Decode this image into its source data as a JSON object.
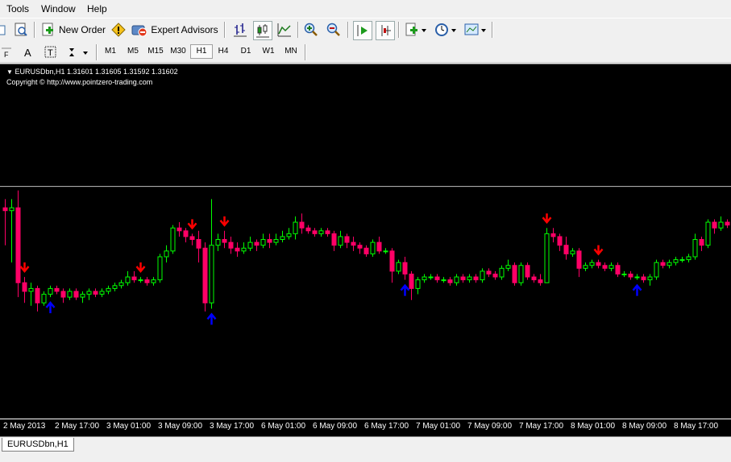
{
  "menu": {
    "items": [
      "Tools",
      "Window",
      "Help"
    ]
  },
  "toolbar": {
    "new_order": "New Order",
    "expert_advisors": "Expert Advisors"
  },
  "timeframes": {
    "items": [
      "M1",
      "M5",
      "M15",
      "M30",
      "H1",
      "H4",
      "D1",
      "W1",
      "MN"
    ],
    "active": "H1"
  },
  "chart": {
    "symbol_line": "EURUSDbn,H1  1.31601 1.31605 1.31592 1.31602",
    "copyright": "Copyright © http://www.pointzero-trading.com",
    "xaxis": [
      "2 May 2013",
      "2 May 17:00",
      "3 May 01:00",
      "3 May 09:00",
      "3 May 17:00",
      "6 May 01:00",
      "6 May 09:00",
      "6 May 17:00",
      "7 May 01:00",
      "7 May 09:00",
      "7 May 17:00",
      "8 May 01:00",
      "8 May 09:00",
      "8 May 17:00"
    ]
  },
  "chart_data": {
    "type": "candlestick",
    "symbol": "EURUSDbn",
    "timeframe": "H1",
    "last_quote": {
      "open": 1.31601,
      "high": 1.31605,
      "low": 1.31592,
      "close": 1.31602
    },
    "colors": {
      "bull": "#00ff00",
      "bear": "#ff0066",
      "background": "#000000",
      "foreground": "#ffffff",
      "bid_line": "#c0c0c0",
      "up_arrow": "#0000ff",
      "down_arrow": "#ff0000"
    },
    "candles": [
      [
        0.31,
        0.3,
        0.34,
        0.18
      ],
      [
        0.3,
        0.31,
        0.34,
        0.12
      ],
      [
        0.31,
        0.05,
        0.37,
        0.0
      ],
      [
        0.05,
        0.02,
        0.07,
        -0.02
      ],
      [
        0.02,
        0.03,
        0.05,
        -0.03
      ],
      [
        0.03,
        -0.02,
        0.04,
        -0.05
      ],
      [
        -0.02,
        0.01,
        0.02,
        -0.03
      ],
      [
        0.01,
        0.03,
        0.04,
        0.0
      ],
      [
        0.03,
        0.02,
        0.04,
        0.01
      ],
      [
        0.02,
        0.0,
        0.03,
        -0.02
      ],
      [
        0.0,
        0.02,
        0.03,
        -0.01
      ],
      [
        0.02,
        0.0,
        0.03,
        -0.01
      ],
      [
        0.0,
        0.01,
        0.02,
        -0.02
      ],
      [
        0.01,
        0.02,
        0.03,
        -0.01
      ],
      [
        0.02,
        0.01,
        0.03,
        0.0
      ],
      [
        0.01,
        0.02,
        0.03,
        0.0
      ],
      [
        0.02,
        0.03,
        0.04,
        0.01
      ],
      [
        0.03,
        0.04,
        0.05,
        0.02
      ],
      [
        0.04,
        0.05,
        0.06,
        0.03
      ],
      [
        0.05,
        0.07,
        0.09,
        0.04
      ],
      [
        0.07,
        0.06,
        0.09,
        0.05
      ],
      [
        0.06,
        0.06,
        0.07,
        0.05
      ],
      [
        0.06,
        0.05,
        0.07,
        0.04
      ],
      [
        0.05,
        0.06,
        0.07,
        0.04
      ],
      [
        0.06,
        0.14,
        0.15,
        0.05
      ],
      [
        0.14,
        0.16,
        0.18,
        0.12
      ],
      [
        0.16,
        0.24,
        0.25,
        0.15
      ],
      [
        0.24,
        0.23,
        0.26,
        0.21
      ],
      [
        0.23,
        0.21,
        0.24,
        0.19
      ],
      [
        0.21,
        0.2,
        0.22,
        0.18
      ],
      [
        0.2,
        0.17,
        0.23,
        0.12
      ],
      [
        0.17,
        -0.02,
        0.19,
        -0.05
      ],
      [
        -0.02,
        0.18,
        0.34,
        -0.04
      ],
      [
        0.18,
        0.2,
        0.22,
        0.16
      ],
      [
        0.2,
        0.19,
        0.23,
        0.17
      ],
      [
        0.19,
        0.17,
        0.21,
        0.15
      ],
      [
        0.17,
        0.16,
        0.19,
        0.14
      ],
      [
        0.16,
        0.17,
        0.19,
        0.15
      ],
      [
        0.17,
        0.19,
        0.21,
        0.16
      ],
      [
        0.19,
        0.18,
        0.2,
        0.16
      ],
      [
        0.18,
        0.2,
        0.22,
        0.17
      ],
      [
        0.2,
        0.19,
        0.22,
        0.17
      ],
      [
        0.19,
        0.2,
        0.22,
        0.18
      ],
      [
        0.2,
        0.21,
        0.23,
        0.19
      ],
      [
        0.21,
        0.22,
        0.24,
        0.2
      ],
      [
        0.22,
        0.26,
        0.28,
        0.2
      ],
      [
        0.26,
        0.24,
        0.29,
        0.22
      ],
      [
        0.24,
        0.23,
        0.25,
        0.22
      ],
      [
        0.23,
        0.22,
        0.24,
        0.21
      ],
      [
        0.22,
        0.23,
        0.24,
        0.21
      ],
      [
        0.23,
        0.22,
        0.24,
        0.21
      ],
      [
        0.22,
        0.18,
        0.23,
        0.16
      ],
      [
        0.18,
        0.21,
        0.23,
        0.17
      ],
      [
        0.21,
        0.19,
        0.22,
        0.17
      ],
      [
        0.19,
        0.18,
        0.21,
        0.16
      ],
      [
        0.18,
        0.17,
        0.19,
        0.15
      ],
      [
        0.17,
        0.15,
        0.18,
        0.14
      ],
      [
        0.15,
        0.19,
        0.2,
        0.14
      ],
      [
        0.19,
        0.16,
        0.21,
        0.15
      ],
      [
        0.16,
        0.16,
        0.17,
        0.15
      ],
      [
        0.16,
        0.09,
        0.17,
        0.05
      ],
      [
        0.09,
        0.12,
        0.13,
        0.08
      ],
      [
        0.12,
        0.08,
        0.14,
        0.06
      ],
      [
        0.08,
        0.03,
        0.09,
        -0.01
      ],
      [
        0.03,
        0.06,
        0.07,
        0.01
      ],
      [
        0.06,
        0.07,
        0.08,
        0.05
      ],
      [
        0.07,
        0.07,
        0.08,
        0.06
      ],
      [
        0.07,
        0.06,
        0.08,
        0.05
      ],
      [
        0.06,
        0.06,
        0.07,
        0.05
      ],
      [
        0.06,
        0.05,
        0.07,
        0.04
      ],
      [
        0.05,
        0.07,
        0.08,
        0.04
      ],
      [
        0.07,
        0.06,
        0.08,
        0.05
      ],
      [
        0.06,
        0.07,
        0.08,
        0.05
      ],
      [
        0.07,
        0.06,
        0.08,
        0.05
      ],
      [
        0.06,
        0.09,
        0.1,
        0.05
      ],
      [
        0.09,
        0.08,
        0.1,
        0.07
      ],
      [
        0.08,
        0.07,
        0.09,
        0.06
      ],
      [
        0.07,
        0.1,
        0.11,
        0.06
      ],
      [
        0.1,
        0.11,
        0.13,
        0.09
      ],
      [
        0.11,
        0.05,
        0.12,
        0.04
      ],
      [
        0.05,
        0.11,
        0.12,
        0.04
      ],
      [
        0.11,
        0.07,
        0.12,
        0.06
      ],
      [
        0.07,
        0.06,
        0.08,
        0.05
      ],
      [
        0.06,
        0.05,
        0.08,
        0.04
      ],
      [
        0.05,
        0.22,
        0.24,
        0.05
      ],
      [
        0.22,
        0.21,
        0.24,
        0.19
      ],
      [
        0.21,
        0.18,
        0.22,
        0.16
      ],
      [
        0.18,
        0.15,
        0.21,
        0.13
      ],
      [
        0.15,
        0.16,
        0.17,
        0.14
      ],
      [
        0.16,
        0.1,
        0.17,
        0.07
      ],
      [
        0.1,
        0.11,
        0.12,
        0.09
      ],
      [
        0.11,
        0.12,
        0.13,
        0.1
      ],
      [
        0.12,
        0.11,
        0.13,
        0.1
      ],
      [
        0.11,
        0.1,
        0.12,
        0.09
      ],
      [
        0.1,
        0.11,
        0.12,
        0.09
      ],
      [
        0.11,
        0.08,
        0.12,
        0.07
      ],
      [
        0.08,
        0.08,
        0.09,
        0.07
      ],
      [
        0.08,
        0.07,
        0.09,
        0.06
      ],
      [
        0.07,
        0.07,
        0.08,
        0.06
      ],
      [
        0.07,
        0.06,
        0.08,
        0.05
      ],
      [
        0.06,
        0.07,
        0.08,
        0.04
      ],
      [
        0.07,
        0.12,
        0.13,
        0.06
      ],
      [
        0.12,
        0.11,
        0.13,
        0.1
      ],
      [
        0.11,
        0.12,
        0.13,
        0.1
      ],
      [
        0.12,
        0.13,
        0.14,
        0.11
      ],
      [
        0.13,
        0.13,
        0.14,
        0.12
      ],
      [
        0.13,
        0.14,
        0.15,
        0.12
      ],
      [
        0.14,
        0.2,
        0.22,
        0.13
      ],
      [
        0.2,
        0.18,
        0.21,
        0.16
      ],
      [
        0.18,
        0.26,
        0.27,
        0.17
      ],
      [
        0.26,
        0.24,
        0.27,
        0.22
      ],
      [
        0.24,
        0.26,
        0.28,
        0.23
      ],
      [
        0.26,
        0.25,
        0.27,
        0.24
      ],
      [
        0.25,
        0.38,
        0.42,
        0.24
      ],
      [
        0.38,
        0.42,
        0.46,
        0.37
      ],
      [
        0.42,
        0.4,
        0.44,
        0.39
      ],
      [
        0.4,
        0.41,
        0.52,
        0.39
      ],
      [
        0.41,
        0.43,
        0.45,
        0.4
      ],
      [
        0.43,
        0.41,
        0.44,
        0.39
      ],
      [
        0.41,
        0.39,
        0.42,
        0.37
      ],
      [
        0.39,
        0.38,
        0.4,
        0.36
      ],
      [
        0.38,
        0.37,
        0.39,
        0.36
      ],
      [
        0.37,
        0.38,
        0.39,
        0.36
      ],
      [
        0.38,
        0.38,
        0.39,
        0.37
      ],
      [
        0.38,
        0.38,
        0.39,
        0.37
      ]
    ],
    "bid": 0.384,
    "up_arrows": [
      7,
      32,
      62,
      98
    ],
    "down_arrows": [
      3,
      21,
      29,
      34,
      84,
      92,
      116
    ]
  }
}
